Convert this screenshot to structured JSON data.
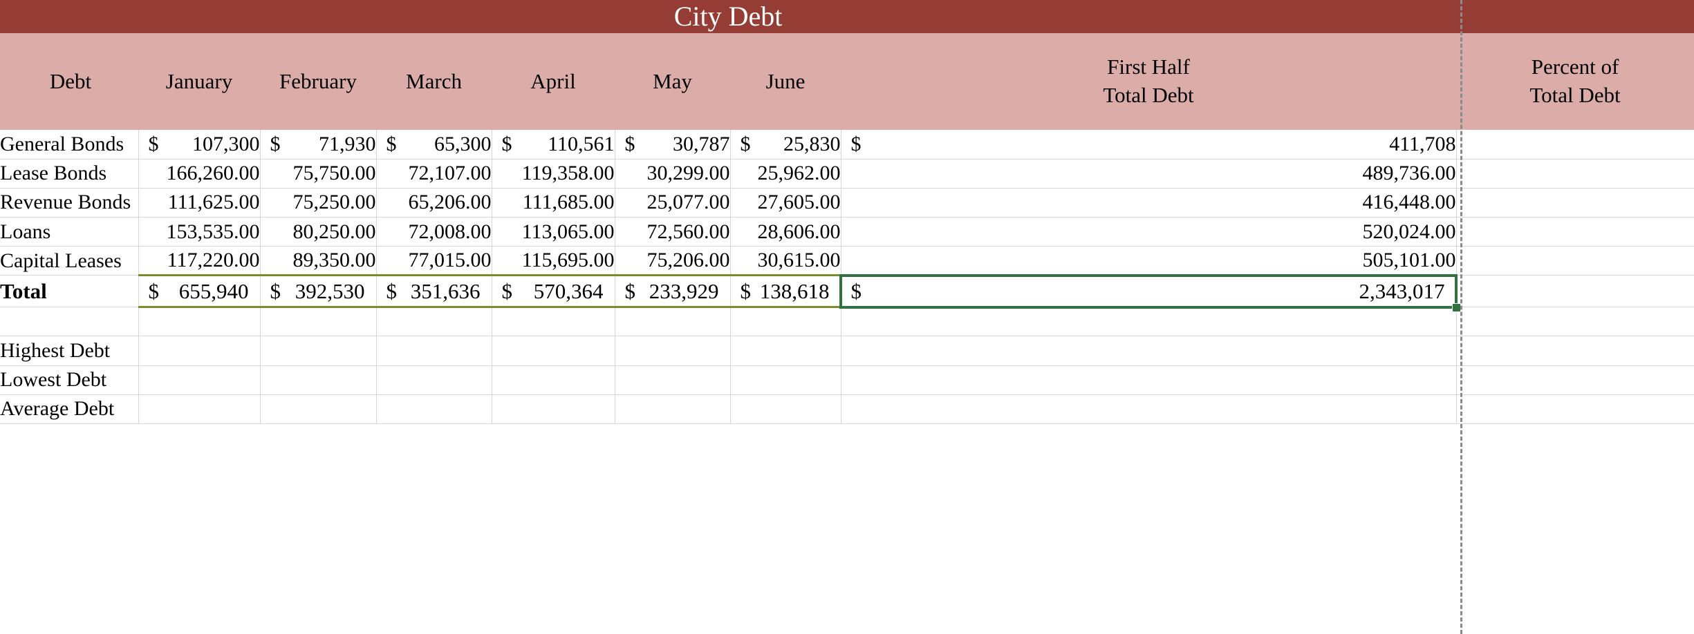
{
  "document": {
    "title": "City Debt",
    "title_bar_color": "#953D34",
    "header_band_color": "#DBACA8",
    "total_border_color": "#7C8C2C",
    "selection_border_color": "#31703F"
  },
  "table": {
    "headers": [
      "Debt",
      "January",
      "February",
      "March",
      "April",
      "May",
      "June",
      "First Half Total Debt",
      "Percent of Total Debt"
    ],
    "header_first_half_line1": "First Half",
    "header_first_half_line2": "Total Debt",
    "header_percent_line1": "Percent of",
    "header_percent_line2": "Total Debt",
    "rows": [
      {
        "label": "General Bonds",
        "currency_symbol": "$",
        "style": "accounting",
        "values": [
          "107,300",
          "71,930",
          "65,300",
          "110,561",
          "30,787",
          "25,830",
          "411,708"
        ],
        "percent": ""
      },
      {
        "label": "Lease Bonds",
        "currency_symbol": "",
        "style": "comma",
        "values": [
          "166,260.00",
          "75,750.00",
          "72,107.00",
          "119,358.00",
          "30,299.00",
          "25,962.00",
          "489,736.00"
        ],
        "percent": ""
      },
      {
        "label": "Revenue Bonds",
        "currency_symbol": "",
        "style": "comma",
        "values": [
          "111,625.00",
          "75,250.00",
          "65,206.00",
          "111,685.00",
          "25,077.00",
          "27,605.00",
          "416,448.00"
        ],
        "percent": ""
      },
      {
        "label": "Loans",
        "currency_symbol": "",
        "style": "comma",
        "values": [
          "153,535.00",
          "80,250.00",
          "72,008.00",
          "113,065.00",
          "72,560.00",
          "28,606.00",
          "520,024.00"
        ],
        "percent": ""
      },
      {
        "label": "Capital Leases",
        "currency_symbol": "",
        "style": "comma",
        "values": [
          "117,220.00",
          "89,350.00",
          "77,015.00",
          "115,695.00",
          "75,206.00",
          "30,615.00",
          "505,101.00"
        ],
        "percent": ""
      }
    ],
    "total_row": {
      "label": "Total",
      "currency_symbol": "$",
      "values": [
        "655,940",
        "392,530",
        "351,636",
        "570,364",
        "233,929",
        "138,618",
        "2,343,017"
      ],
      "percent": ""
    },
    "summary_rows": [
      {
        "label": "",
        "values": [
          "",
          "",
          "",
          "",
          "",
          "",
          ""
        ],
        "percent": ""
      },
      {
        "label": "Highest Debt",
        "values": [
          "",
          "",
          "",
          "",
          "",
          "",
          ""
        ],
        "percent": ""
      },
      {
        "label": "Lowest Debt",
        "values": [
          "",
          "",
          "",
          "",
          "",
          "",
          ""
        ],
        "percent": ""
      },
      {
        "label": "Average Debt",
        "values": [
          "",
          "",
          "",
          "",
          "",
          "",
          ""
        ],
        "percent": ""
      }
    ]
  },
  "selection": {
    "cell_value": "2,343,017",
    "cell_currency": "$",
    "cell_reference": "Total / First Half Total Debt"
  }
}
